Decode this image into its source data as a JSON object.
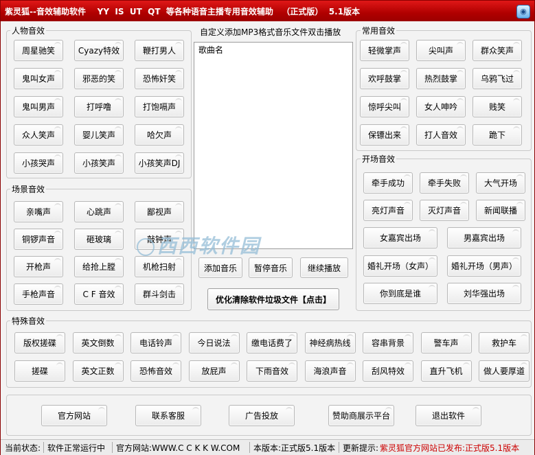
{
  "window": {
    "title": "紫灵狐--音效辅助软件    YY  IS  UT  QT  等各种语音主播专用音效辅助   （正式版）  5.1版本",
    "corner_icon": "app-icon"
  },
  "people": {
    "title": "人物音效",
    "buttons": [
      "周星驰笑",
      "Cyazy特效",
      "鞭打男人",
      "鬼叫女声",
      "邪恶的笑",
      "恐怖奸笑",
      "鬼叫男声",
      "打呼噜",
      "打饱嗝声",
      "众人笑声",
      "婴儿笑声",
      "哈欠声",
      "小孩哭声",
      "小孩笑声",
      "小孩笑声DJ"
    ]
  },
  "scene": {
    "title": "场景音效",
    "buttons": [
      "亲嘴声",
      "心跳声",
      "鄙视声",
      "铜锣声音",
      "砸玻璃",
      "敲钟声",
      "开枪声",
      "给抢上膛",
      "机枪扫射",
      "手枪声音",
      "C F 音效",
      "群斗剑击"
    ]
  },
  "playlist": {
    "hint": "自定义添加MP3格式音乐文件双击播放",
    "column": "歌曲名",
    "add": "添加音乐",
    "pause": "暂停音乐",
    "resume": "继续播放",
    "clean": "优化清除软件垃圾文件【点击】"
  },
  "common": {
    "title": "常用音效",
    "buttons": [
      "轻微掌声",
      "尖叫声",
      "群众笑声",
      "欢呼鼓掌",
      "热烈鼓掌",
      "乌鸦飞过",
      "惊呼尖叫",
      "女人呻吟",
      "贱笑",
      "保镖出来",
      "打人音效",
      "跪下"
    ]
  },
  "opening": {
    "title": "开场音效",
    "buttons": [
      "牵手成功",
      "牵手失败",
      "大气开场",
      "亮灯声音",
      "灭灯声音",
      "新闻联播",
      "女嘉宾出场",
      "男嘉宾出场",
      "婚礼开场（女声）",
      "婚礼开场（男声）",
      "你到底是谁",
      "刘华强出场"
    ]
  },
  "special": {
    "title": "特殊音效",
    "buttons": [
      "版权搓碟",
      "英文倒数",
      "电话铃声",
      "今日说法",
      "缴电话费了",
      "神经病热线",
      "容串背景",
      "警车声",
      "救护车",
      "搓碟",
      "英文正数",
      "恐怖音效",
      "放屁声",
      "下雨音效",
      "海浪声音",
      "刮风特效",
      "直升飞机",
      "做人要厚道"
    ]
  },
  "footer": {
    "buttons": [
      "官方网站",
      "联系客服",
      "广告投放",
      "赞助商展示平台",
      "退出软件"
    ]
  },
  "status": {
    "label": "当前状态:",
    "state": "软件正常运行中",
    "site": "官方网站:WWW.C C K K W.COM",
    "version": "本版本:正式版5.1版本",
    "update_label": "更新提示:",
    "update_text": "紫灵狐官方网站已发布:正式版5.1版本",
    "update_color": "#cc0000"
  },
  "watermark": {
    "text": "西西软件园"
  }
}
